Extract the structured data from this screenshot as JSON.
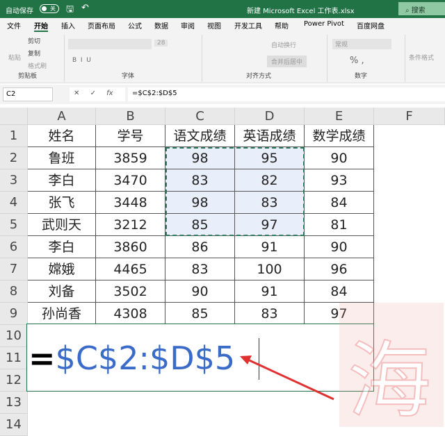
{
  "titlebar": {
    "autosave": "自动保存",
    "toggle": "关",
    "title": "新建 Microsoft Excel 工作表.xlsx",
    "search": "搜索"
  },
  "tabs": [
    "文件",
    "开始",
    "插入",
    "页面布局",
    "公式",
    "数据",
    "审阅",
    "视图",
    "开发工具",
    "帮助",
    "Power Pivot",
    "百度网盘"
  ],
  "ribbon": {
    "paste": "粘贴",
    "cut": "剪切",
    "copy": "复制",
    "format_painter": "格式刷",
    "font_size": "28",
    "wrap": "自动换行",
    "merge": "合并后居中",
    "number_format": "常规",
    "cond_format": "条件格式",
    "groups": [
      "剪贴板",
      "字体",
      "对齐方式",
      "数字"
    ]
  },
  "formula_bar": {
    "name_box": "C2",
    "formula": "=$C$2:$D$5"
  },
  "columns": [
    "A",
    "B",
    "C",
    "D",
    "E",
    "F"
  ],
  "rows": [
    "1",
    "2",
    "3",
    "4",
    "5",
    "6",
    "7",
    "8",
    "9",
    "10",
    "11",
    "12",
    "13",
    "14"
  ],
  "table": [
    [
      "姓名",
      "学号",
      "语文成绩",
      "英语成绩",
      "数学成绩"
    ],
    [
      "鲁班",
      "3859",
      "98",
      "95",
      "90"
    ],
    [
      "李白",
      "3470",
      "83",
      "82",
      "93"
    ],
    [
      "张飞",
      "3448",
      "98",
      "83",
      "84"
    ],
    [
      "武则天",
      "3212",
      "85",
      "97",
      "81"
    ],
    [
      "李白",
      "3860",
      "86",
      "91",
      "90"
    ],
    [
      "嫦娥",
      "4465",
      "83",
      "100",
      "96"
    ],
    [
      "刘备",
      "3502",
      "90",
      "91",
      "84"
    ],
    [
      "孙尚香",
      "4308",
      "85",
      "83",
      "97"
    ]
  ],
  "merged_cell": {
    "eq": "=",
    "ref": "$C$2:$D$5"
  },
  "watermark": "海",
  "colors": {
    "accent": "#217346",
    "reference": "#3a6bc9",
    "arrow": "#e03030"
  }
}
